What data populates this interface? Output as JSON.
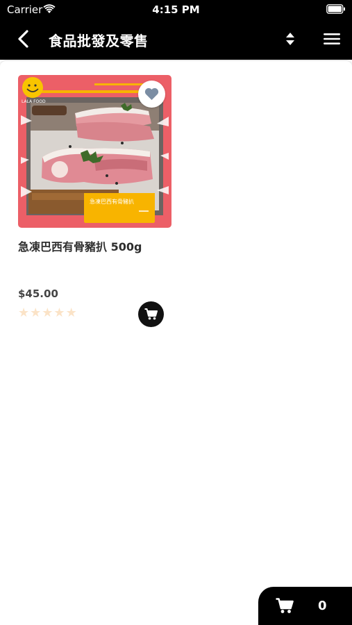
{
  "status_bar": {
    "carrier": "Carrier",
    "time": "4:15 PM",
    "wifi_icon": "wifi-icon",
    "battery_icon": "battery-icon"
  },
  "nav_bar": {
    "title": "食品批發及零售",
    "back_icon": "chevron-left-icon",
    "sort_icon": "sort-updown-icon",
    "menu_icon": "hamburger-menu-icon",
    "background": "#000000"
  },
  "products": [
    {
      "name": "急凍巴西有骨豬扒 500g",
      "price": "$45.00",
      "rating": 0,
      "max_rating": 5,
      "image_label": "急凍巴西有骨豬扒",
      "brand_logo_text": "LALA FOOD",
      "favorite_icon": "heart-icon",
      "add_to_cart_icon": "cart-icon"
    }
  ],
  "cart": {
    "count": "0",
    "icon": "cart-icon"
  },
  "colors": {
    "star_empty": "#fbe3c7",
    "image_frame": "#ec5f67",
    "image_accent": "#f8b400"
  }
}
